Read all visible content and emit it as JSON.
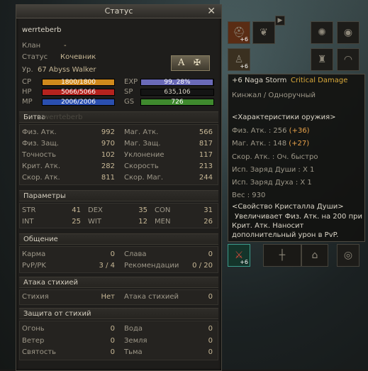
{
  "window": {
    "title": "Статус",
    "close_glyph": "✕"
  },
  "character": {
    "name": "werrteberb",
    "clan_label": "Клан",
    "clan_value": "-",
    "status_label": "Статус",
    "status_value": "Кочевник",
    "level_label": "Ур.",
    "level_value": "67 Abyss Walker",
    "badge_a": "A",
    "badge_b": "✠"
  },
  "bars": {
    "cp_label": "CP",
    "cp_value": "1800/1800",
    "cp_color": "#d08a1c",
    "hp_label": "HP",
    "hp_value": "5066/5066",
    "hp_color": "#b5231e",
    "mp_label": "MP",
    "mp_value": "2006/2006",
    "mp_color": "#2a4fb0",
    "exp_label": "EXP",
    "exp_value": "99, 28%",
    "exp_progress": 0.9928,
    "exp_color": "#6a6ab8",
    "sp_label": "SP",
    "sp_value": "635,106",
    "gs_label": "GS",
    "gs_value": "726",
    "gs_color": "#3f8a2e"
  },
  "battle": {
    "header": "Битва",
    "watermark": "werrteberb",
    "left": [
      {
        "label": "Физ. Атк.",
        "value": "992"
      },
      {
        "label": "Физ. Защ.",
        "value": "970"
      },
      {
        "label": "Точность",
        "value": "102"
      },
      {
        "label": "Крит. Атк.",
        "value": "282"
      },
      {
        "label": "Скор. Атк.",
        "value": "811"
      }
    ],
    "right": [
      {
        "label": "Маг. Атк.",
        "value": "566"
      },
      {
        "label": "Маг. Защ.",
        "value": "817"
      },
      {
        "label": "Уклонение",
        "value": "117"
      },
      {
        "label": "Скорость",
        "value": "213"
      },
      {
        "label": "Скор. Маг.",
        "value": "244"
      }
    ]
  },
  "params": {
    "header": "Параметры",
    "row1": [
      {
        "label": "STR",
        "value": "41"
      },
      {
        "label": "DEX",
        "value": "35"
      },
      {
        "label": "CON",
        "value": "31"
      }
    ],
    "row2": [
      {
        "label": "INT",
        "value": "25"
      },
      {
        "label": "WIT",
        "value": "12"
      },
      {
        "label": "MEN",
        "value": "26"
      }
    ]
  },
  "social": {
    "header": "Общение",
    "left": [
      {
        "label": "Карма",
        "value": "0"
      },
      {
        "label": "PvP/PK",
        "value": "3 / 4"
      }
    ],
    "right": [
      {
        "label": "Слава",
        "value": "0"
      },
      {
        "label": "Рекомендации",
        "value": "0 / 20"
      }
    ]
  },
  "element_attack": {
    "header": "Атака стихией",
    "left_label": "Стихия",
    "left_value": "Нет",
    "right_label": "Атака стихией",
    "right_value": "0"
  },
  "element_defense": {
    "header": "Защита от стихий",
    "left": [
      {
        "label": "Огонь",
        "value": "0"
      },
      {
        "label": "Ветер",
        "value": "0"
      },
      {
        "label": "Святость",
        "value": "0"
      }
    ],
    "right": [
      {
        "label": "Вода",
        "value": "0"
      },
      {
        "label": "Земля",
        "value": "0"
      },
      {
        "label": "Тьма",
        "value": "0"
      }
    ]
  },
  "equipment": {
    "plus_badge": "+6",
    "arrow_glyph": "▶",
    "slot_icons": [
      "helmet-icon",
      "necklace-icon",
      "cloak-icon",
      "shield-icon",
      "armor-icon",
      "gloves-icon",
      "mask-icon"
    ]
  },
  "tooltip": {
    "enchant": "+6",
    "name": "Naga Storm",
    "special": "Critical Damage",
    "type": "Кинжал / Одноручный",
    "section": "<Характеристики оружия>",
    "patk_label": "Физ. Атк. : 256",
    "patk_bonus": "(+36)",
    "matk_label": "Маг. Атк. : 148",
    "matk_bonus": "(+27)",
    "speed": "Скор. Атк. : Оч. быстро",
    "soulshot": "Исп. Заряд Души : X 1",
    "spiritshot": "Исп. Заряд Духа : X 1",
    "weight": "Вес : 930",
    "crystal_title": "<Свойство Кристалла Души>",
    "crystal_line1": "Увеличивает Физ. Атк. на 200 при",
    "crystal_line2": "Крит. Атк. Наносит",
    "crystal_line3": "дополнительный урон в PvP."
  },
  "weapon_slot": {
    "plus": "+6"
  }
}
